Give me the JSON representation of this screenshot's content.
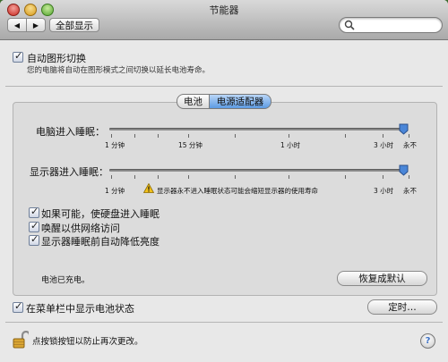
{
  "window": {
    "title": "节能器"
  },
  "toolbar": {
    "back": "◀",
    "forward": "▶",
    "show_all": "全部显示"
  },
  "search": {
    "placeholder": ""
  },
  "auto_graphics": {
    "checked": true,
    "label": "自动图形切换",
    "description": "您的电脑将自动在图形模式之间切换以延长电池寿命。"
  },
  "tabs": [
    {
      "label": "电池",
      "selected": false
    },
    {
      "label": "电源适配器",
      "selected": true
    }
  ],
  "computer_sleep": {
    "label": "电脑进入睡眠：",
    "value_label": "永不",
    "ticks": [
      "1 分钟",
      "15 分钟",
      "1 小时",
      "3 小时",
      "永不"
    ]
  },
  "display_sleep": {
    "label": "显示器进入睡眠：",
    "value_label": "永不",
    "ticks": [
      "1 分钟",
      "3 小时",
      "永不"
    ],
    "warning": "显示器永不进入睡眠状态可能会缩短显示器的使用寿命"
  },
  "options": [
    {
      "label": "如果可能，使硬盘进入睡眠",
      "checked": true
    },
    {
      "label": "唤醒以供网络访问",
      "checked": true
    },
    {
      "label": "显示器睡眠前自动降低亮度",
      "checked": true
    }
  ],
  "battery_status": "电池已充电。",
  "restore_defaults": "恢复成默认",
  "menubar_battery": {
    "label": "在菜单栏中显示电池状态",
    "checked": true
  },
  "schedule_button": "定时…",
  "lock_text": "点按锁按钮以防止再次更改。",
  "help": "?",
  "colors": {
    "selected_segment": "#5d9be3",
    "thumb": "#4a86d8",
    "warning": "#f2c11b"
  }
}
